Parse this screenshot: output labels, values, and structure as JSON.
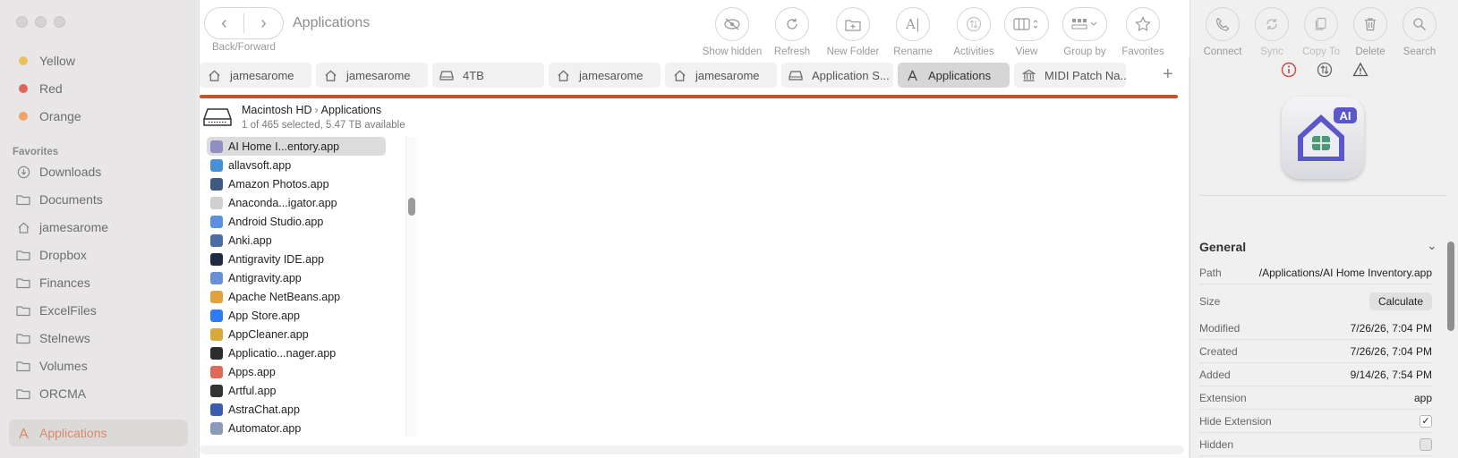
{
  "sidebar": {
    "tags": [
      {
        "label": "Yellow",
        "color": "#e8c25a"
      },
      {
        "label": "Red",
        "color": "#e0645a"
      },
      {
        "label": "Orange",
        "color": "#eea46a"
      }
    ],
    "favorites_header": "Favorites",
    "favorites": [
      {
        "label": "Downloads",
        "icon": "download-icon"
      },
      {
        "label": "Documents",
        "icon": "folder-icon"
      },
      {
        "label": "jamesarome",
        "icon": "home-icon"
      },
      {
        "label": "Dropbox",
        "icon": "folder-icon"
      },
      {
        "label": "Finances",
        "icon": "folder-icon"
      },
      {
        "label": "ExcelFiles",
        "icon": "folder-icon"
      },
      {
        "label": "Stelnews",
        "icon": "folder-icon"
      },
      {
        "label": "Volumes",
        "icon": "folder-icon"
      },
      {
        "label": "ORCMA",
        "icon": "folder-icon"
      },
      {
        "label": "Applications",
        "icon": "applications-icon",
        "active": true
      }
    ]
  },
  "toolbar": {
    "nav_label": "Back/Forward",
    "title": "Applications",
    "buttons": [
      {
        "label": "Show hidden",
        "icon": "eye-slash-icon"
      },
      {
        "label": "Refresh",
        "icon": "refresh-icon"
      },
      {
        "label": "New Folder",
        "icon": "new-folder-icon"
      },
      {
        "label": "Rename",
        "icon": "rename-icon"
      },
      {
        "label": "Activities",
        "icon": "activities-icon"
      },
      {
        "label": "View",
        "icon": "columns-view-icon"
      },
      {
        "label": "Group by",
        "icon": "group-by-icon"
      },
      {
        "label": "Favorites",
        "icon": "star-icon"
      }
    ]
  },
  "tabs": [
    {
      "label": "jamesarome",
      "icon": "home-icon"
    },
    {
      "label": "jamesarome",
      "icon": "home-icon"
    },
    {
      "label": "4TB",
      "icon": "drive-icon"
    },
    {
      "label": "jamesarome",
      "icon": "home-icon"
    },
    {
      "label": "jamesarome",
      "icon": "home-icon"
    },
    {
      "label": "Application S...",
      "icon": "drive-icon"
    },
    {
      "label": "Applications",
      "icon": "applications-icon",
      "active": true
    },
    {
      "label": "MIDI Patch Na...",
      "icon": "bank-icon"
    }
  ],
  "accent_bar_color": "#c4532f",
  "path": {
    "segments": [
      "Macintosh HD",
      "Applications"
    ],
    "status": "1 of 465 selected, 5.47 TB available"
  },
  "files": [
    {
      "name": "AI Home I...entory.app",
      "selected": true,
      "color": "#8f8fc4"
    },
    {
      "name": "allavsoft.app",
      "color": "#4a90d9"
    },
    {
      "name": "Amazon Photos.app",
      "color": "#3d5a80"
    },
    {
      "name": "Anaconda...igator.app",
      "color": "#cfcfcf"
    },
    {
      "name": "Android Studio.app",
      "color": "#5b8fe0"
    },
    {
      "name": "Anki.app",
      "color": "#4c6ea8"
    },
    {
      "name": "Antigravity IDE.app",
      "color": "#1f2a44"
    },
    {
      "name": "Antigravity.app",
      "color": "#6a8fd6"
    },
    {
      "name": "Apache NetBeans.app",
      "color": "#e2a23b"
    },
    {
      "name": "App Store.app",
      "color": "#2f7bf6"
    },
    {
      "name": "AppCleaner.app",
      "color": "#d9a93a"
    },
    {
      "name": "Applicatio...nager.app",
      "color": "#2b2b2b"
    },
    {
      "name": "Apps.app",
      "color": "#e06a5a"
    },
    {
      "name": "Artful.app",
      "color": "#333333"
    },
    {
      "name": "AstraChat.app",
      "color": "#3a5bb0"
    },
    {
      "name": "Automator.app",
      "color": "#8a9ab8"
    }
  ],
  "inspector": {
    "buttons": [
      {
        "label": "Connect",
        "icon": "phone-icon",
        "dim": false
      },
      {
        "label": "Sync",
        "icon": "sync-icon",
        "dim": true
      },
      {
        "label": "Copy To",
        "icon": "copy-icon",
        "dim": true
      },
      {
        "label": "Delete",
        "icon": "trash-icon",
        "dim": false
      },
      {
        "label": "Search",
        "icon": "search-icon",
        "dim": false
      }
    ],
    "app_badge": "AI",
    "section_title": "General",
    "path_label": "Path",
    "path_value": "/Applications/AI Home Inventory.app",
    "size_label": "Size",
    "calculate_label": "Calculate",
    "modified_label": "Modified",
    "modified_value": "7/26/26, 7:04 PM",
    "created_label": "Created",
    "created_value": "7/26/26, 7:04 PM",
    "added_label": "Added",
    "added_value": "9/14/26, 7:54 PM",
    "extension_label": "Extension",
    "extension_value": "app",
    "hide_extension_label": "Hide Extension",
    "hide_extension_checked": true,
    "hidden_label": "Hidden",
    "hidden_checked": false
  }
}
